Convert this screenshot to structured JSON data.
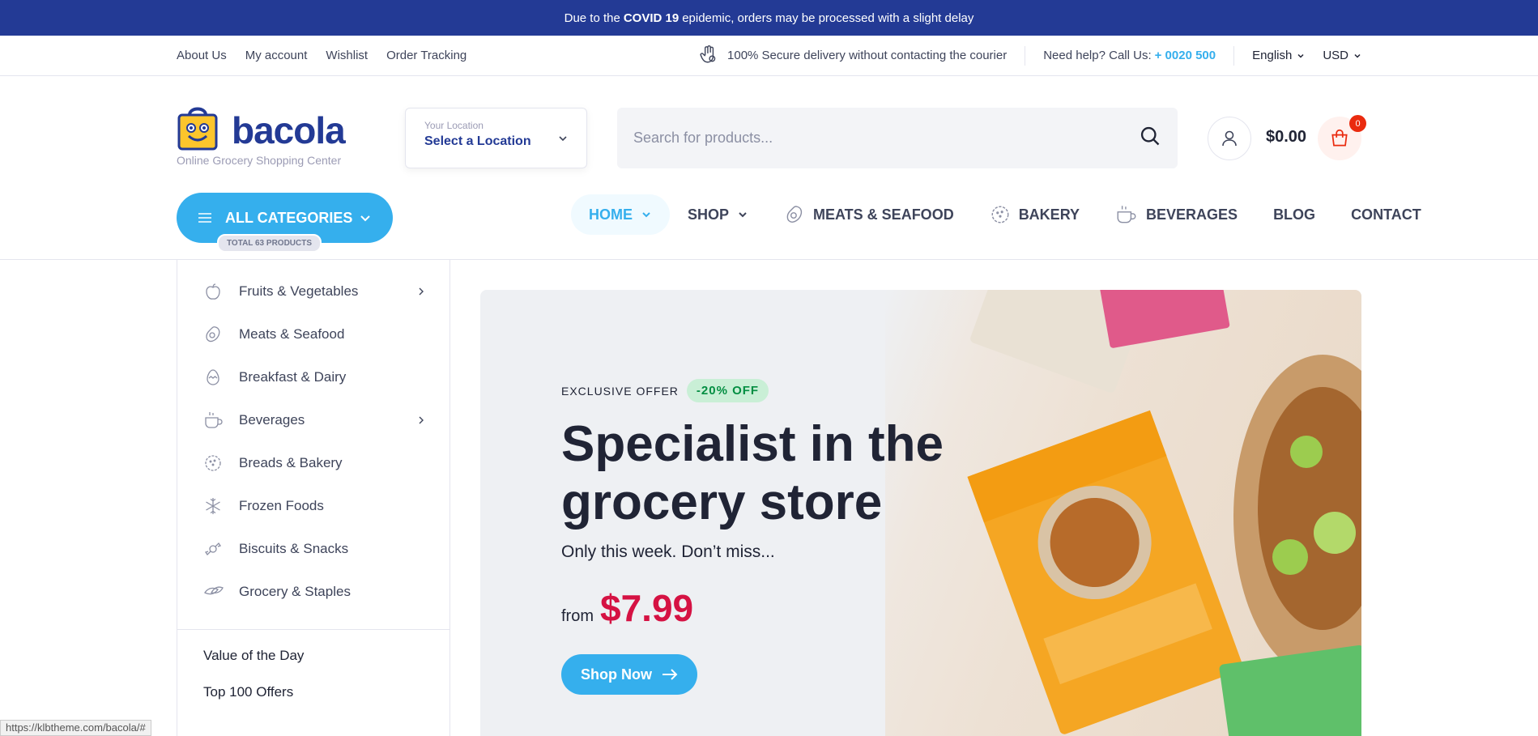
{
  "topbar": {
    "pre": "Due to the",
    "bold": "COVID 19",
    "post": "epidemic, orders may be processed with a slight delay"
  },
  "subbar": {
    "links": [
      "About Us",
      "My account",
      "Wishlist",
      "Order Tracking"
    ],
    "secure": "100% Secure delivery without contacting the courier",
    "help_label": "Need help? Call Us:",
    "help_phone": "+ 0020 500",
    "language": "English",
    "currency": "USD"
  },
  "logo": {
    "word": "bacola",
    "tagline": "Online Grocery Shopping Center"
  },
  "location": {
    "label": "Your Location",
    "value": "Select a Location"
  },
  "search": {
    "placeholder": "Search for products..."
  },
  "cart": {
    "total": "$0.00",
    "count": "0"
  },
  "all_categories": {
    "label": "ALL CATEGORIES",
    "total": "TOTAL 63 PRODUCTS"
  },
  "menu": [
    {
      "label": "HOME",
      "icon": "",
      "dropdown": true
    },
    {
      "label": "SHOP",
      "icon": "",
      "dropdown": true
    },
    {
      "label": "MEATS & SEAFOOD",
      "icon": "meat-icon"
    },
    {
      "label": "BAKERY",
      "icon": "bakery-icon"
    },
    {
      "label": "BEVERAGES",
      "icon": "cup-icon"
    },
    {
      "label": "BLOG",
      "icon": ""
    },
    {
      "label": "CONTACT",
      "icon": ""
    }
  ],
  "categories": [
    {
      "label": "Fruits & Vegetables",
      "icon": "apple-icon",
      "sub": true
    },
    {
      "label": "Meats & Seafood",
      "icon": "meat-icon",
      "sub": false
    },
    {
      "label": "Breakfast & Dairy",
      "icon": "egg-icon",
      "sub": false
    },
    {
      "label": "Beverages",
      "icon": "cup-icon",
      "sub": true
    },
    {
      "label": "Breads & Bakery",
      "icon": "bakery-icon",
      "sub": false
    },
    {
      "label": "Frozen Foods",
      "icon": "snowflake-icon",
      "sub": false
    },
    {
      "label": "Biscuits & Snacks",
      "icon": "candy-icon",
      "sub": false
    },
    {
      "label": "Grocery & Staples",
      "icon": "leaf-icon",
      "sub": false
    }
  ],
  "sidebar_extra": [
    "Value of the Day",
    "Top 100 Offers"
  ],
  "hero": {
    "offer": "EXCLUSIVE OFFER",
    "discount": "-20% OFF",
    "title": "Specialist in the grocery store",
    "subtitle": "Only this week. Don’t miss...",
    "from": "from",
    "price": "$7.99",
    "button": "Shop Now"
  },
  "status_url": "https://klbtheme.com/bacola/#",
  "colors": {
    "brand": "#233a95",
    "accent": "#35afed",
    "price": "#d51243",
    "badge": "#ea2b0f"
  }
}
